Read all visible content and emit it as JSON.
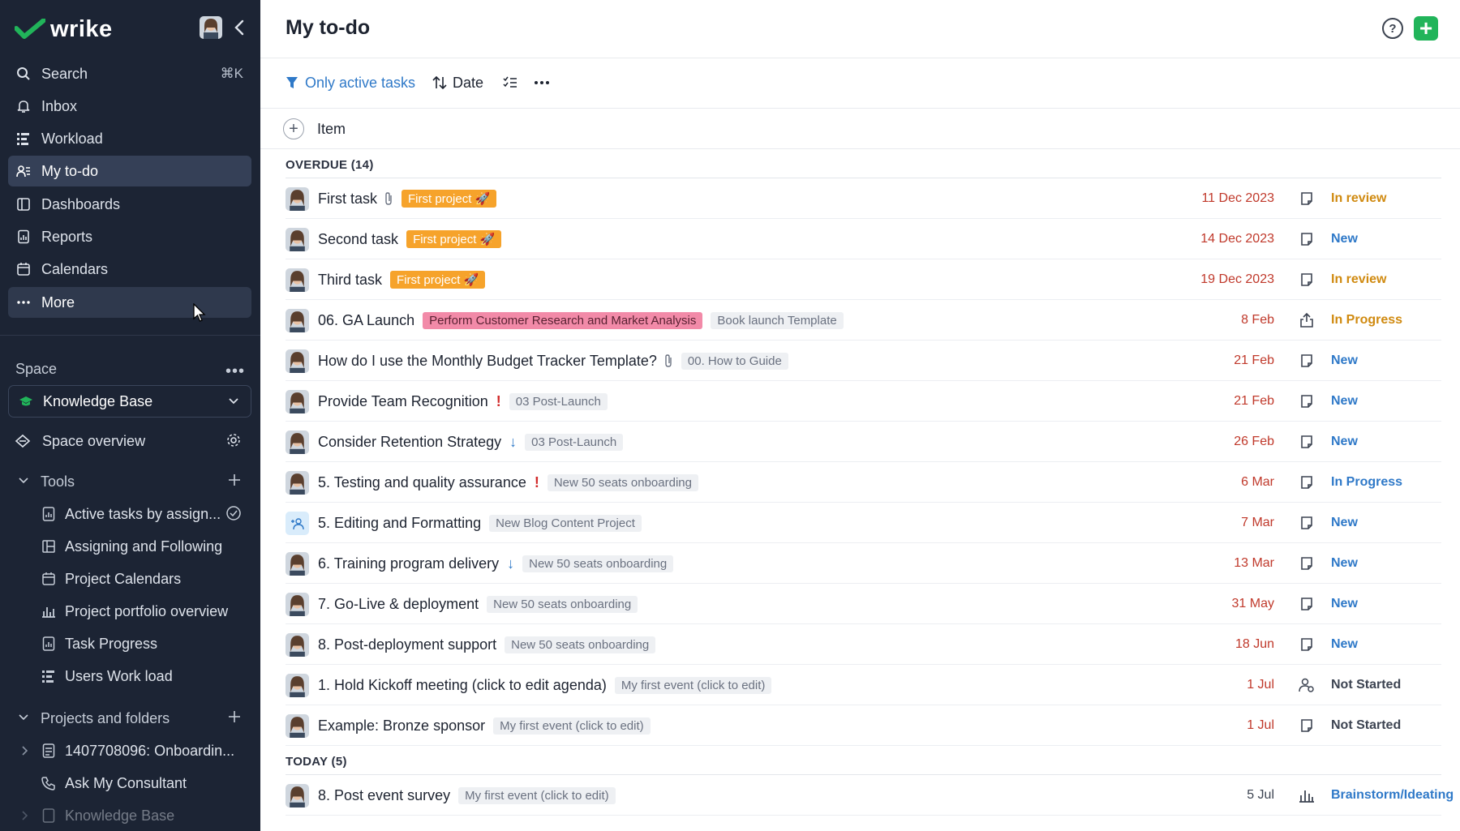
{
  "app": {
    "logo_text": "wrike"
  },
  "sidebar": {
    "nav": [
      {
        "label": "Search",
        "shortcut": "⌘K"
      },
      {
        "label": "Inbox"
      },
      {
        "label": "Workload"
      },
      {
        "label": "My to-do"
      },
      {
        "label": "Dashboards"
      },
      {
        "label": "Reports"
      },
      {
        "label": "Calendars"
      },
      {
        "label": "More"
      }
    ],
    "space_label": "Space",
    "space_name": "Knowledge Base",
    "space_overview": "Space overview",
    "tools_label": "Tools",
    "tools": [
      "Active tasks by assign...",
      "Assigning and Following",
      "Project Calendars",
      "Project portfolio overview",
      "Task Progress",
      "Users Work load"
    ],
    "projects_label": "Projects and folders",
    "projects": [
      "1407708096: Onboardin...",
      "Ask My Consultant",
      "Knowledge Base"
    ]
  },
  "main": {
    "title": "My to-do",
    "filter_label": "Only active tasks",
    "sort_label": "Date",
    "add_item_label": "Item",
    "groups": [
      {
        "label": "OVERDUE (14)",
        "tasks": [
          {
            "name": "First task",
            "attachment": true,
            "tags": [
              {
                "text": "First project 🚀",
                "style": "orange"
              }
            ],
            "date": "11 Dec 2023",
            "type": "task",
            "status": "In review",
            "status_class": "st-review"
          },
          {
            "name": "Second task",
            "tags": [
              {
                "text": "First project 🚀",
                "style": "orange"
              }
            ],
            "date": "14 Dec 2023",
            "type": "task",
            "status": "New",
            "status_class": "st-new"
          },
          {
            "name": "Third task",
            "tags": [
              {
                "text": "First project 🚀",
                "style": "orange"
              }
            ],
            "date": "19 Dec 2023",
            "type": "task",
            "status": "In review",
            "status_class": "st-review"
          },
          {
            "name": "06. GA Launch",
            "tags": [
              {
                "text": "Perform Customer Research and Market Analysis",
                "style": "pink"
              },
              {
                "text": "Book launch Template",
                "style": "gray"
              }
            ],
            "date": "8 Feb",
            "type": "share",
            "status": "In Progress",
            "status_class": "st-progress"
          },
          {
            "name": "How do I use the Monthly Budget Tracker Template?",
            "attachment": true,
            "tags": [
              {
                "text": "00. How to Guide",
                "style": "gray"
              }
            ],
            "date": "21 Feb",
            "type": "task",
            "status": "New",
            "status_class": "st-new"
          },
          {
            "name": "Provide Team Recognition",
            "importance": "high",
            "tags": [
              {
                "text": "03 Post-Launch",
                "style": "gray"
              }
            ],
            "date": "21 Feb",
            "type": "task",
            "status": "New",
            "status_class": "st-new"
          },
          {
            "name": "Consider Retention Strategy",
            "importance": "low",
            "tags": [
              {
                "text": "03 Post-Launch",
                "style": "gray"
              }
            ],
            "date": "26 Feb",
            "type": "task",
            "status": "New",
            "status_class": "st-new"
          },
          {
            "name": "5. Testing and quality assurance",
            "importance": "high",
            "tags": [
              {
                "text": "New 50 seats onboarding",
                "style": "gray"
              }
            ],
            "date": "6 Mar",
            "type": "task",
            "status": "In Progress",
            "status_class": "st-progress-blue"
          },
          {
            "name": "5. Editing and Formatting",
            "invite": true,
            "tags": [
              {
                "text": "New Blog Content Project",
                "style": "gray"
              }
            ],
            "date": "7 Mar",
            "type": "task",
            "status": "New",
            "status_class": "st-new"
          },
          {
            "name": "6. Training program delivery",
            "importance": "low",
            "tags": [
              {
                "text": "New 50 seats onboarding",
                "style": "gray"
              }
            ],
            "date": "13 Mar",
            "type": "task",
            "status": "New",
            "status_class": "st-new"
          },
          {
            "name": "7. Go-Live & deployment",
            "tags": [
              {
                "text": "New 50 seats onboarding",
                "style": "gray"
              }
            ],
            "date": "31 May",
            "type": "task",
            "status": "New",
            "status_class": "st-new"
          },
          {
            "name": "8. Post-deployment support",
            "tags": [
              {
                "text": "New 50 seats onboarding",
                "style": "gray"
              }
            ],
            "date": "18 Jun",
            "type": "task",
            "status": "New",
            "status_class": "st-new"
          },
          {
            "name": "1. Hold Kickoff meeting (click to edit agenda)",
            "tags": [
              {
                "text": "My first event (click to edit)",
                "style": "gray"
              }
            ],
            "date": "1 Jul",
            "type": "people",
            "status": "Not Started",
            "status_class": "st-notstarted"
          },
          {
            "name": "Example: Bronze sponsor",
            "tags": [
              {
                "text": "My first event (click to edit)",
                "style": "gray"
              }
            ],
            "date": "1 Jul",
            "type": "task",
            "status": "Not Started",
            "status_class": "st-notstarted"
          }
        ]
      },
      {
        "label": "TODAY (5)",
        "tasks": [
          {
            "name": "8. Post event survey",
            "tags": [
              {
                "text": "My first event (click to edit)",
                "style": "gray"
              }
            ],
            "date": "5 Jul",
            "today": true,
            "type": "chart",
            "status": "Brainstorm/Ideating",
            "status_class": "st-brain"
          }
        ]
      }
    ]
  },
  "colors": {
    "sidebar_bg": "#1c2434",
    "accent_blue": "#2f79c8",
    "brand_green": "#21b45a",
    "overdue_red": "#c0392b"
  }
}
